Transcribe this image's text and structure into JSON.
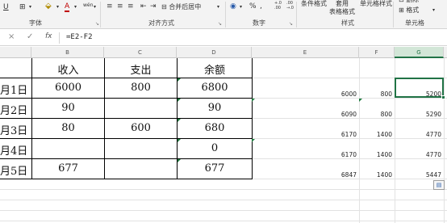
{
  "ribbon": {
    "format_buttons": [
      "U",
      "⊞",
      "A",
      "A",
      "wén"
    ],
    "merge_label": "合并后居中",
    "percent_symbol": "%",
    "comma_symbol": ",",
    "decimal_inc": "+.0 .00",
    "decimal_dec": ".00 →.0",
    "cond_format": "条件格式",
    "table_format": "套用\n表格格式",
    "cell_style": "单元格样式",
    "delete_label": "删除",
    "format_label": "格式",
    "groups": [
      "字体",
      "对齐方式",
      "数字",
      "样式",
      "单元格"
    ]
  },
  "formula_bar": {
    "cancel": "×",
    "confirm": "✓",
    "fx": "fx",
    "formula": "=E2-F2"
  },
  "columns": [
    "B",
    "C",
    "D",
    "E",
    "F",
    "G"
  ],
  "table": {
    "headers": [
      "收入",
      "支出",
      "余额"
    ],
    "rows": [
      {
        "date": "月1日",
        "income": "6000",
        "expense": "800",
        "balance": "6800"
      },
      {
        "date": "月2日",
        "income": "90",
        "expense": "",
        "balance": "90"
      },
      {
        "date": "月3日",
        "income": "80",
        "expense": "600",
        "balance": "680"
      },
      {
        "date": "月4日",
        "income": "",
        "expense": "",
        "balance": "0"
      },
      {
        "date": "月5日",
        "income": "677",
        "expense": "",
        "balance": "677"
      }
    ]
  },
  "calc": [
    {
      "e": "6000",
      "f": "800",
      "g": "5200"
    },
    {
      "e": "6090",
      "f": "800",
      "g": "5290"
    },
    {
      "e": "6170",
      "f": "1400",
      "g": "4770"
    },
    {
      "e": "6170",
      "f": "1400",
      "g": "4770"
    },
    {
      "e": "6847",
      "f": "1400",
      "g": "5447"
    }
  ],
  "quick_analysis_icon": "paste-options-icon",
  "colors": {
    "accent": "#217346",
    "triangle": "#1d7a3e"
  }
}
